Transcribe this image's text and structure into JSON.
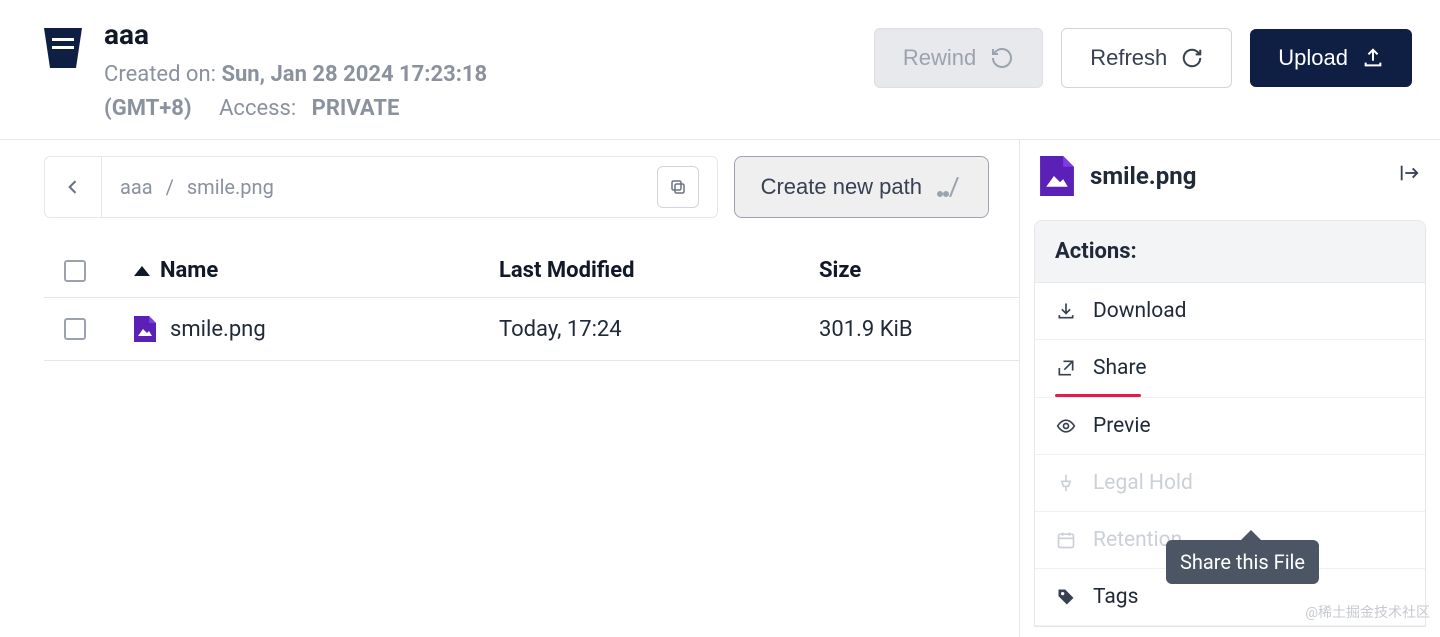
{
  "header": {
    "title": "aaa",
    "created_label": "Created on:",
    "created_value": "Sun, Jan 28 2024 17:23:18",
    "gmt": "(GMT+8)",
    "access_label": "Access:",
    "access_value": "PRIVATE",
    "rewind": "Rewind",
    "refresh": "Refresh",
    "upload": "Upload"
  },
  "path": {
    "bucket": "aaa",
    "file": "smile.png",
    "create_label": "Create new path"
  },
  "table": {
    "name_header": "Name",
    "modified_header": "Last Modified",
    "size_header": "Size",
    "rows": [
      {
        "name": "smile.png",
        "modified": "Today, 17:24",
        "size": "301.9 KiB"
      }
    ]
  },
  "detail": {
    "filename": "smile.png",
    "actions_title": "Actions:",
    "download": "Download",
    "share": "Share",
    "preview": "Previe",
    "legal_hold": "Legal Hold",
    "retention": "Retention",
    "tags": "Tags",
    "tooltip": "Share this File"
  },
  "watermark": "@稀土掘金技术社区"
}
